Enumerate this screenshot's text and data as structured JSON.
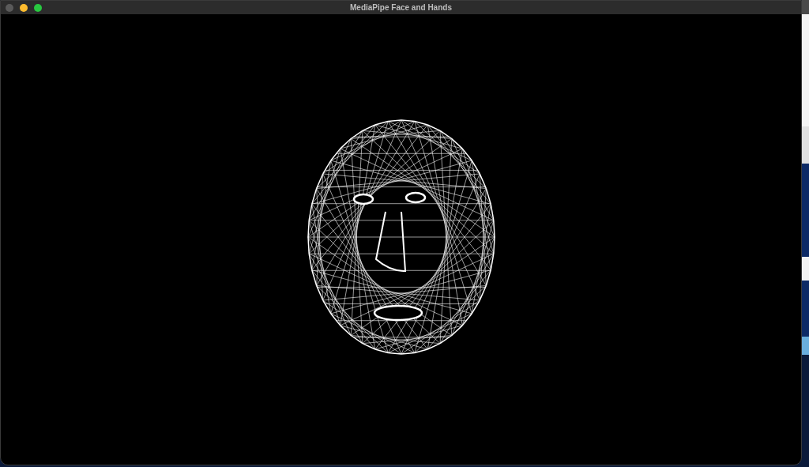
{
  "window": {
    "title": "MediaPipe Face and Hands",
    "buttons": [
      {
        "kind": "close",
        "disabled": true
      },
      {
        "kind": "minimize",
        "disabled": false
      },
      {
        "kind": "zoom",
        "disabled": false
      }
    ]
  }
}
